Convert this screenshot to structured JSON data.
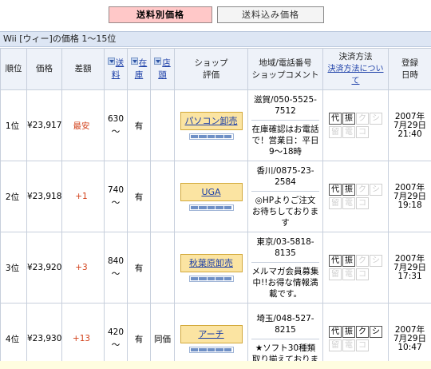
{
  "tabs": {
    "active_label": "送料別価格",
    "inactive_label": "送料込み価格"
  },
  "section": {
    "title": "Wii [ウィー]の価格 1～15位"
  },
  "table": {
    "headers": {
      "rank": "順位",
      "price": "価格",
      "diff": "差額",
      "ship_line1": "送",
      "ship_line2": "料",
      "stock_line1": "在",
      "stock_line2": "庫",
      "store_line1": "店",
      "store_line2": "頭",
      "shop_line1": "ショップ",
      "shop_line2": "評価",
      "region_line1": "地域/電話番号",
      "region_line2": "ショップコメント",
      "payment_title": "決済方法",
      "payment_link_line1": "決済方法につい",
      "payment_link_line2": "て",
      "date_line1": "登録",
      "date_line2": "日時"
    },
    "rows": [
      {
        "rank": "1位",
        "price": "¥23,917",
        "diff": "最安",
        "ship": "630",
        "ship_tilde": "～",
        "stock": "有",
        "store": "",
        "shop": "パソコン卸売",
        "region": "滋賀/050-5525-7512",
        "comment": "在庫確認はお電話で！営業日：平日9～18時",
        "pay": [
          "代",
          "振",
          "ク",
          "シ",
          "留",
          "電",
          "コ"
        ],
        "pay_on": [
          true,
          true,
          false,
          false,
          false,
          false,
          false
        ],
        "date_year": "2007年",
        "date_day": "7月29日",
        "date_time": "21:40"
      },
      {
        "rank": "2位",
        "price": "¥23,918",
        "diff": "+1",
        "ship": "740",
        "ship_tilde": "～",
        "stock": "有",
        "store": "",
        "shop": "UGA",
        "region": "香川/0875-23-2584",
        "comment": "◎HPよりご注文お待ちしております",
        "pay": [
          "代",
          "振",
          "ク",
          "シ",
          "留",
          "電",
          "コ"
        ],
        "pay_on": [
          true,
          true,
          false,
          false,
          false,
          false,
          false
        ],
        "date_year": "2007年",
        "date_day": "7月29日",
        "date_time": "19:18"
      },
      {
        "rank": "3位",
        "price": "¥23,920",
        "diff": "+3",
        "ship": "840",
        "ship_tilde": "～",
        "stock": "有",
        "store": "",
        "shop": "秋葉原卸売",
        "region": "東京/03-5818-8135",
        "comment": "メルマガ会員募集中!!お得な情報満載です。",
        "pay": [
          "代",
          "振",
          "ク",
          "シ",
          "留",
          "電",
          "コ"
        ],
        "pay_on": [
          true,
          true,
          false,
          false,
          false,
          false,
          false
        ],
        "date_year": "2007年",
        "date_day": "7月29日",
        "date_time": "17:31"
      },
      {
        "rank": "4位",
        "price": "¥23,930",
        "diff": "+13",
        "ship": "420",
        "ship_tilde": "～",
        "stock": "有",
        "store": "同価",
        "shop": "アーチ",
        "region": "埼玉/048-527-8215",
        "comment": "★ソフト30種類取り揃えておりま",
        "pay": [
          "代",
          "振",
          "ク",
          "シ",
          "留",
          "電",
          "コ"
        ],
        "pay_on": [
          true,
          true,
          true,
          true,
          false,
          false,
          false
        ],
        "date_year": "2007年",
        "date_day": "7月29日",
        "date_time": "10:47"
      }
    ]
  },
  "colors": {
    "active_tab": "#ffc8c8",
    "header_band": "#dde6f4",
    "diff_red": "#d2411a",
    "shop_button": "#fbe4a2",
    "link_blue": "#1c3fa8"
  }
}
